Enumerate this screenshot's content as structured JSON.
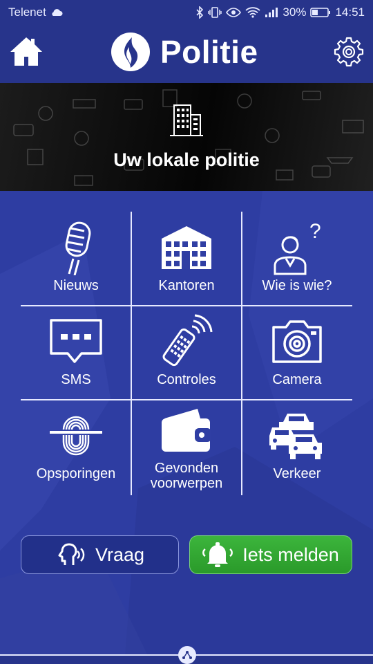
{
  "statusbar": {
    "carrier": "Telenet",
    "battery": "30%",
    "time": "14:51"
  },
  "header": {
    "title": "Politie"
  },
  "banner": {
    "title": "Uw lokale politie"
  },
  "menu": {
    "items": [
      {
        "label": "Nieuws",
        "icon": "microphone-icon"
      },
      {
        "label": "Kantoren",
        "icon": "building-icon"
      },
      {
        "label": "Wie is wie?",
        "icon": "person-question-icon"
      },
      {
        "label": "SMS",
        "icon": "sms-icon"
      },
      {
        "label": "Controles",
        "icon": "speed-gun-icon"
      },
      {
        "label": "Camera",
        "icon": "camera-icon"
      },
      {
        "label": "Opsporingen",
        "icon": "fingerprint-icon"
      },
      {
        "label": "Gevonden voorwerpen",
        "icon": "wallet-icon"
      },
      {
        "label": "Verkeer",
        "icon": "cars-icon"
      }
    ]
  },
  "actions": {
    "vraag_label": "Vraag",
    "melden_label": "Iets melden"
  },
  "colors": {
    "header_bg": "#27348b",
    "main_bg": "#2f3ea3",
    "melden_green": "#2fa62f"
  }
}
